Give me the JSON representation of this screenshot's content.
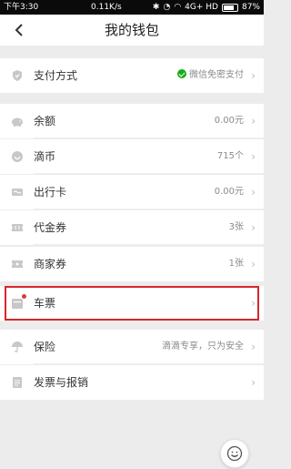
{
  "status_bar": {
    "time": "下午3:30",
    "network_speed": "0.11K/s",
    "network_type": "4G+ HD",
    "battery": "87%"
  },
  "header": {
    "title": "我的钱包",
    "back_icon": "back-arrow-icon"
  },
  "payment": {
    "label": "支付方式",
    "value": "微信免密支付",
    "icon": "shield-icon"
  },
  "items": [
    {
      "label": "余额",
      "value": "0.00元",
      "icon": "piggy-bank-icon"
    },
    {
      "label": "滴币",
      "value": "715个",
      "icon": "coin-icon"
    },
    {
      "label": "出行卡",
      "value": "0.00元",
      "icon": "card-icon"
    },
    {
      "label": "代金券",
      "value": "3张",
      "icon": "voucher-icon"
    },
    {
      "label": "商家券",
      "value": "1张",
      "icon": "coupon-icon"
    }
  ],
  "ticket": {
    "label": "车票",
    "value": "",
    "icon": "ticket-icon"
  },
  "insurance": {
    "label": "保险",
    "value": "滴滴专享，只为安全",
    "icon": "umbrella-icon"
  },
  "invoice": {
    "label": "发票与报销",
    "value": "",
    "icon": "invoice-icon"
  },
  "colors": {
    "accent": "#1aad19",
    "highlight": "#d6262b",
    "background": "#ececec"
  }
}
